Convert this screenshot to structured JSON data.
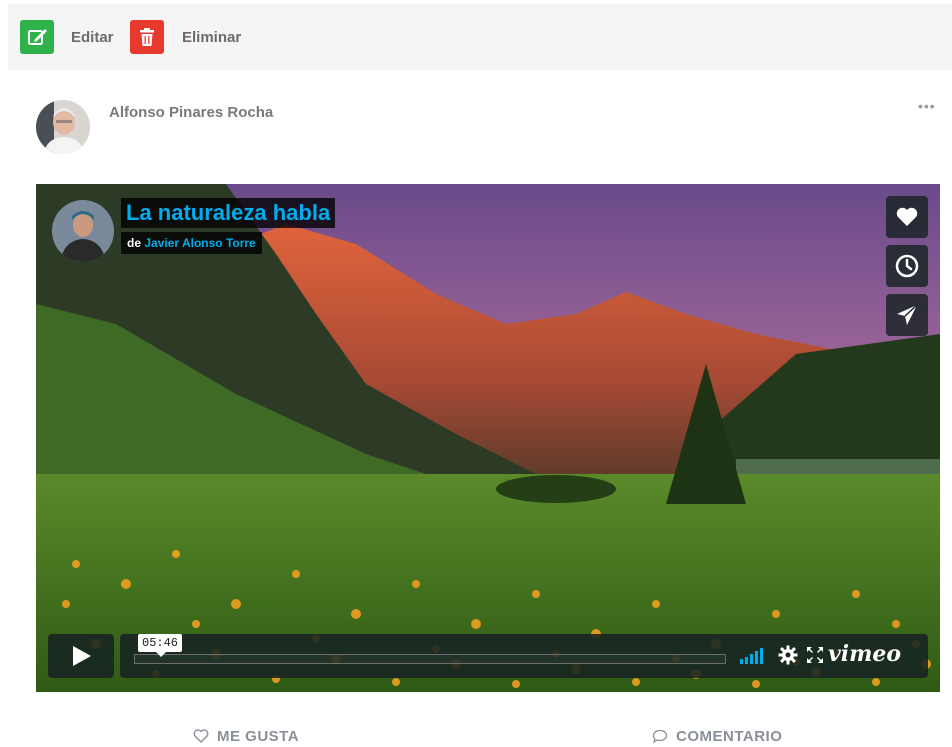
{
  "toolbar": {
    "edit_label": "Editar",
    "delete_label": "Eliminar",
    "edit_icon": "edit-icon",
    "delete_icon": "trash-icon",
    "edit_color": "#2fb24a",
    "delete_color": "#e8392f"
  },
  "post": {
    "author": "Alfonso Pinares Rocha",
    "more_glyph": "•••"
  },
  "video": {
    "title": "La naturaleza habla",
    "byline_prefix": "de",
    "byline_author": "Javier Alonso Torre",
    "duration": "05:46",
    "provider": "vimeo",
    "accent": "#00adef",
    "side_buttons": [
      "heart-icon",
      "clock-icon",
      "send-icon"
    ]
  },
  "actions": {
    "like_label": "ME GUSTA",
    "comment_label": "COMENTARIO"
  }
}
